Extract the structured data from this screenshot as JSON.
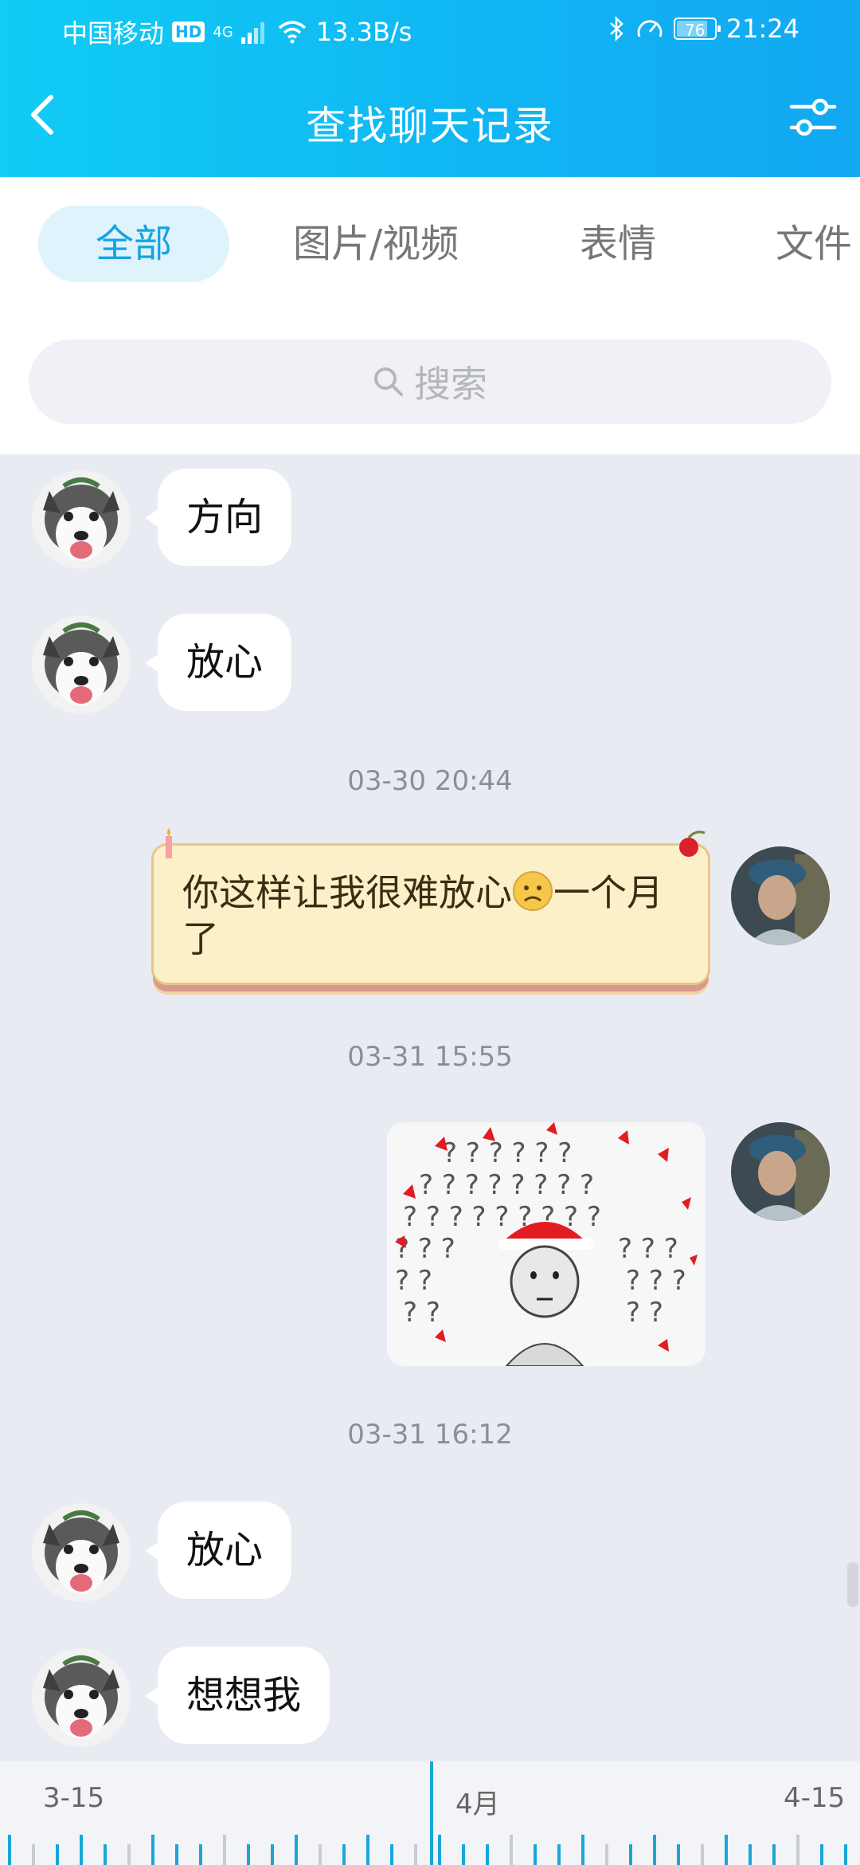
{
  "status_bar": {
    "carrier": "中国移动",
    "hd": "HD",
    "network": "4G",
    "speed": "13.3B/s",
    "battery": "76",
    "time": "21:24"
  },
  "header": {
    "title": "查找聊天记录",
    "back_icon": "chevron-left-icon",
    "filter_icon": "sliders-icon"
  },
  "tabs": [
    {
      "label": "全部",
      "active": true
    },
    {
      "label": "图片/视频",
      "active": false
    },
    {
      "label": "表情",
      "active": false
    },
    {
      "label": "文件",
      "active": false
    }
  ],
  "search": {
    "placeholder": "搜索"
  },
  "messages": [
    {
      "side": "left",
      "type": "text",
      "text": "方向"
    },
    {
      "side": "left",
      "type": "text",
      "text": "放心"
    },
    {
      "type": "timestamp",
      "text": "03-30 20:44"
    },
    {
      "side": "right",
      "type": "fancy-text",
      "text_before": "你这样让我很难放心",
      "text_after": "一个月了",
      "emoji": "worried-face-emoji"
    },
    {
      "type": "timestamp",
      "text": "03-31 15:55"
    },
    {
      "side": "right",
      "type": "sticker",
      "sticker": "question-marks-santa-hat-sticker"
    },
    {
      "type": "timestamp",
      "text": "03-31 16:12"
    },
    {
      "side": "left",
      "type": "text",
      "text": "放心"
    },
    {
      "side": "left",
      "type": "text",
      "text": "想想我"
    }
  ],
  "timeline": {
    "start_label": "3-15",
    "mid_label": "4月",
    "end_label": "4-15"
  },
  "colors": {
    "header_start": "#10cdf5",
    "header_end": "#12a8f2",
    "active_tab_text": "#12a5e0",
    "active_tab_bg": "#dff3fc",
    "chat_bg": "#e9ebf3",
    "timeline_tick": "#1aa6d8"
  }
}
